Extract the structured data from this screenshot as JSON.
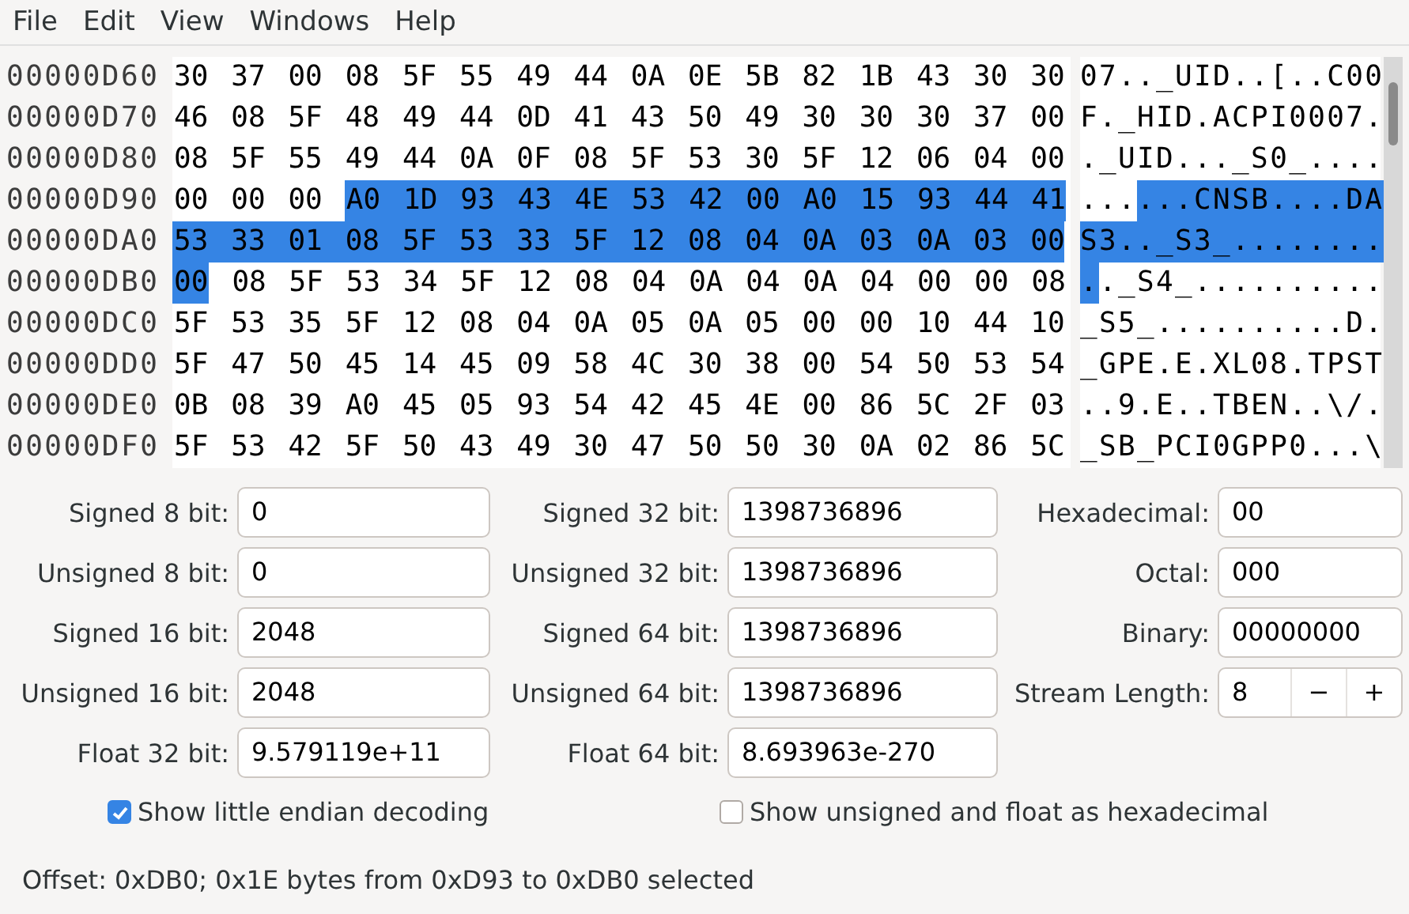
{
  "menu": [
    "File",
    "Edit",
    "View",
    "Windows",
    "Help"
  ],
  "hex_view": {
    "rows": [
      {
        "offset": "00000D60",
        "hex": [
          {
            "text": "30 37 00 08 5F 55 49 44 0A 0E 5B 82 1B 43 30 30",
            "selected": false
          }
        ],
        "ascii": [
          {
            "text": "07.._UID..[..C00",
            "selected": false
          }
        ]
      },
      {
        "offset": "00000D70",
        "hex": [
          {
            "text": "46 08 5F 48 49 44 0D 41 43 50 49 30 30 30 37 00",
            "selected": false
          }
        ],
        "ascii": [
          {
            "text": "F._HID.ACPI0007.",
            "selected": false
          }
        ]
      },
      {
        "offset": "00000D80",
        "hex": [
          {
            "text": "08 5F 55 49 44 0A 0F 08 5F 53 30 5F 12 06 04 00",
            "selected": false
          }
        ],
        "ascii": [
          {
            "text": "._UID..._S0_....",
            "selected": false
          }
        ]
      },
      {
        "offset": "00000D90",
        "hex": [
          {
            "text": "00 00 00",
            "selected": false
          },
          {
            "text": "A0 1D 93 43 4E 53 42 00 A0 15 93 44 41",
            "selected": true
          }
        ],
        "ascii": [
          {
            "text": "...",
            "selected": false
          },
          {
            "text": "...CNSB....DA",
            "selected": true
          }
        ]
      },
      {
        "offset": "00000DA0",
        "hex": [
          {
            "text": "53 33 01 08 5F 53 33 5F 12 08 04 0A 03 0A 03 00",
            "selected": true
          }
        ],
        "ascii": [
          {
            "text": "S3.._S3_........",
            "selected": true
          }
        ]
      },
      {
        "offset": "00000DB0",
        "hex": [
          {
            "text": "00",
            "selected": true
          },
          {
            "text": "08 5F 53 34 5F 12 08 04 0A 04 0A 04 00 00 08",
            "selected": false
          }
        ],
        "ascii": [
          {
            "text": ".",
            "selected": true
          },
          {
            "text": "._S4_..........",
            "selected": false
          }
        ]
      },
      {
        "offset": "00000DC0",
        "hex": [
          {
            "text": "5F 53 35 5F 12 08 04 0A 05 0A 05 00 00 10 44 10",
            "selected": false
          }
        ],
        "ascii": [
          {
            "text": "_S5_..........D.",
            "selected": false
          }
        ]
      },
      {
        "offset": "00000DD0",
        "hex": [
          {
            "text": "5F 47 50 45 14 45 09 58 4C 30 38 00 54 50 53 54",
            "selected": false
          }
        ],
        "ascii": [
          {
            "text": "_GPE.E.XL08.TPST",
            "selected": false
          }
        ]
      },
      {
        "offset": "00000DE0",
        "hex": [
          {
            "text": "0B 08 39 A0 45 05 93 54 42 45 4E 00 86 5C 2F 03",
            "selected": false
          }
        ],
        "ascii": [
          {
            "text": "..9.E..TBEN..\\/.",
            "selected": false
          }
        ]
      },
      {
        "offset": "00000DF0",
        "hex": [
          {
            "text": "5F 53 42 5F 50 43 49 30 47 50 50 30 0A 02 86 5C",
            "selected": false
          }
        ],
        "ascii": [
          {
            "text": "_SB_PCI0GPP0...\\",
            "selected": false
          }
        ]
      }
    ]
  },
  "decoders": [
    {
      "kind": "field",
      "label": "Signed 8 bit:",
      "value": "0"
    },
    {
      "kind": "field",
      "label": "Signed 32 bit:",
      "value": "1398736896"
    },
    {
      "kind": "field",
      "label": "Hexadecimal:",
      "value": "00"
    },
    {
      "kind": "field",
      "label": "Unsigned 8 bit:",
      "value": "0"
    },
    {
      "kind": "field",
      "label": "Unsigned 32 bit:",
      "value": "1398736896"
    },
    {
      "kind": "field",
      "label": "Octal:",
      "value": "000"
    },
    {
      "kind": "field",
      "label": "Signed 16 bit:",
      "value": "2048"
    },
    {
      "kind": "field",
      "label": "Signed 64 bit:",
      "value": "1398736896"
    },
    {
      "kind": "field",
      "label": "Binary:",
      "value": "00000000"
    },
    {
      "kind": "field",
      "label": "Unsigned 16 bit:",
      "value": "2048"
    },
    {
      "kind": "field",
      "label": "Unsigned 64 bit:",
      "value": "1398736896"
    },
    {
      "kind": "spinner",
      "label": "Stream Length:",
      "value": "8",
      "decrement": "−",
      "increment": "+"
    },
    {
      "kind": "field",
      "label": "Float 32 bit:",
      "value": "9.579119e+11"
    },
    {
      "kind": "field",
      "label": "Float 64 bit:",
      "value": "8.693963e-270"
    }
  ],
  "options": [
    {
      "label": "Show little endian decoding",
      "checked": true
    },
    {
      "label": "Show unsigned and float as hexadecimal",
      "checked": false
    }
  ],
  "status_bar": "Offset: 0xDB0; 0x1E bytes from 0xD93 to 0xDB0 selected"
}
